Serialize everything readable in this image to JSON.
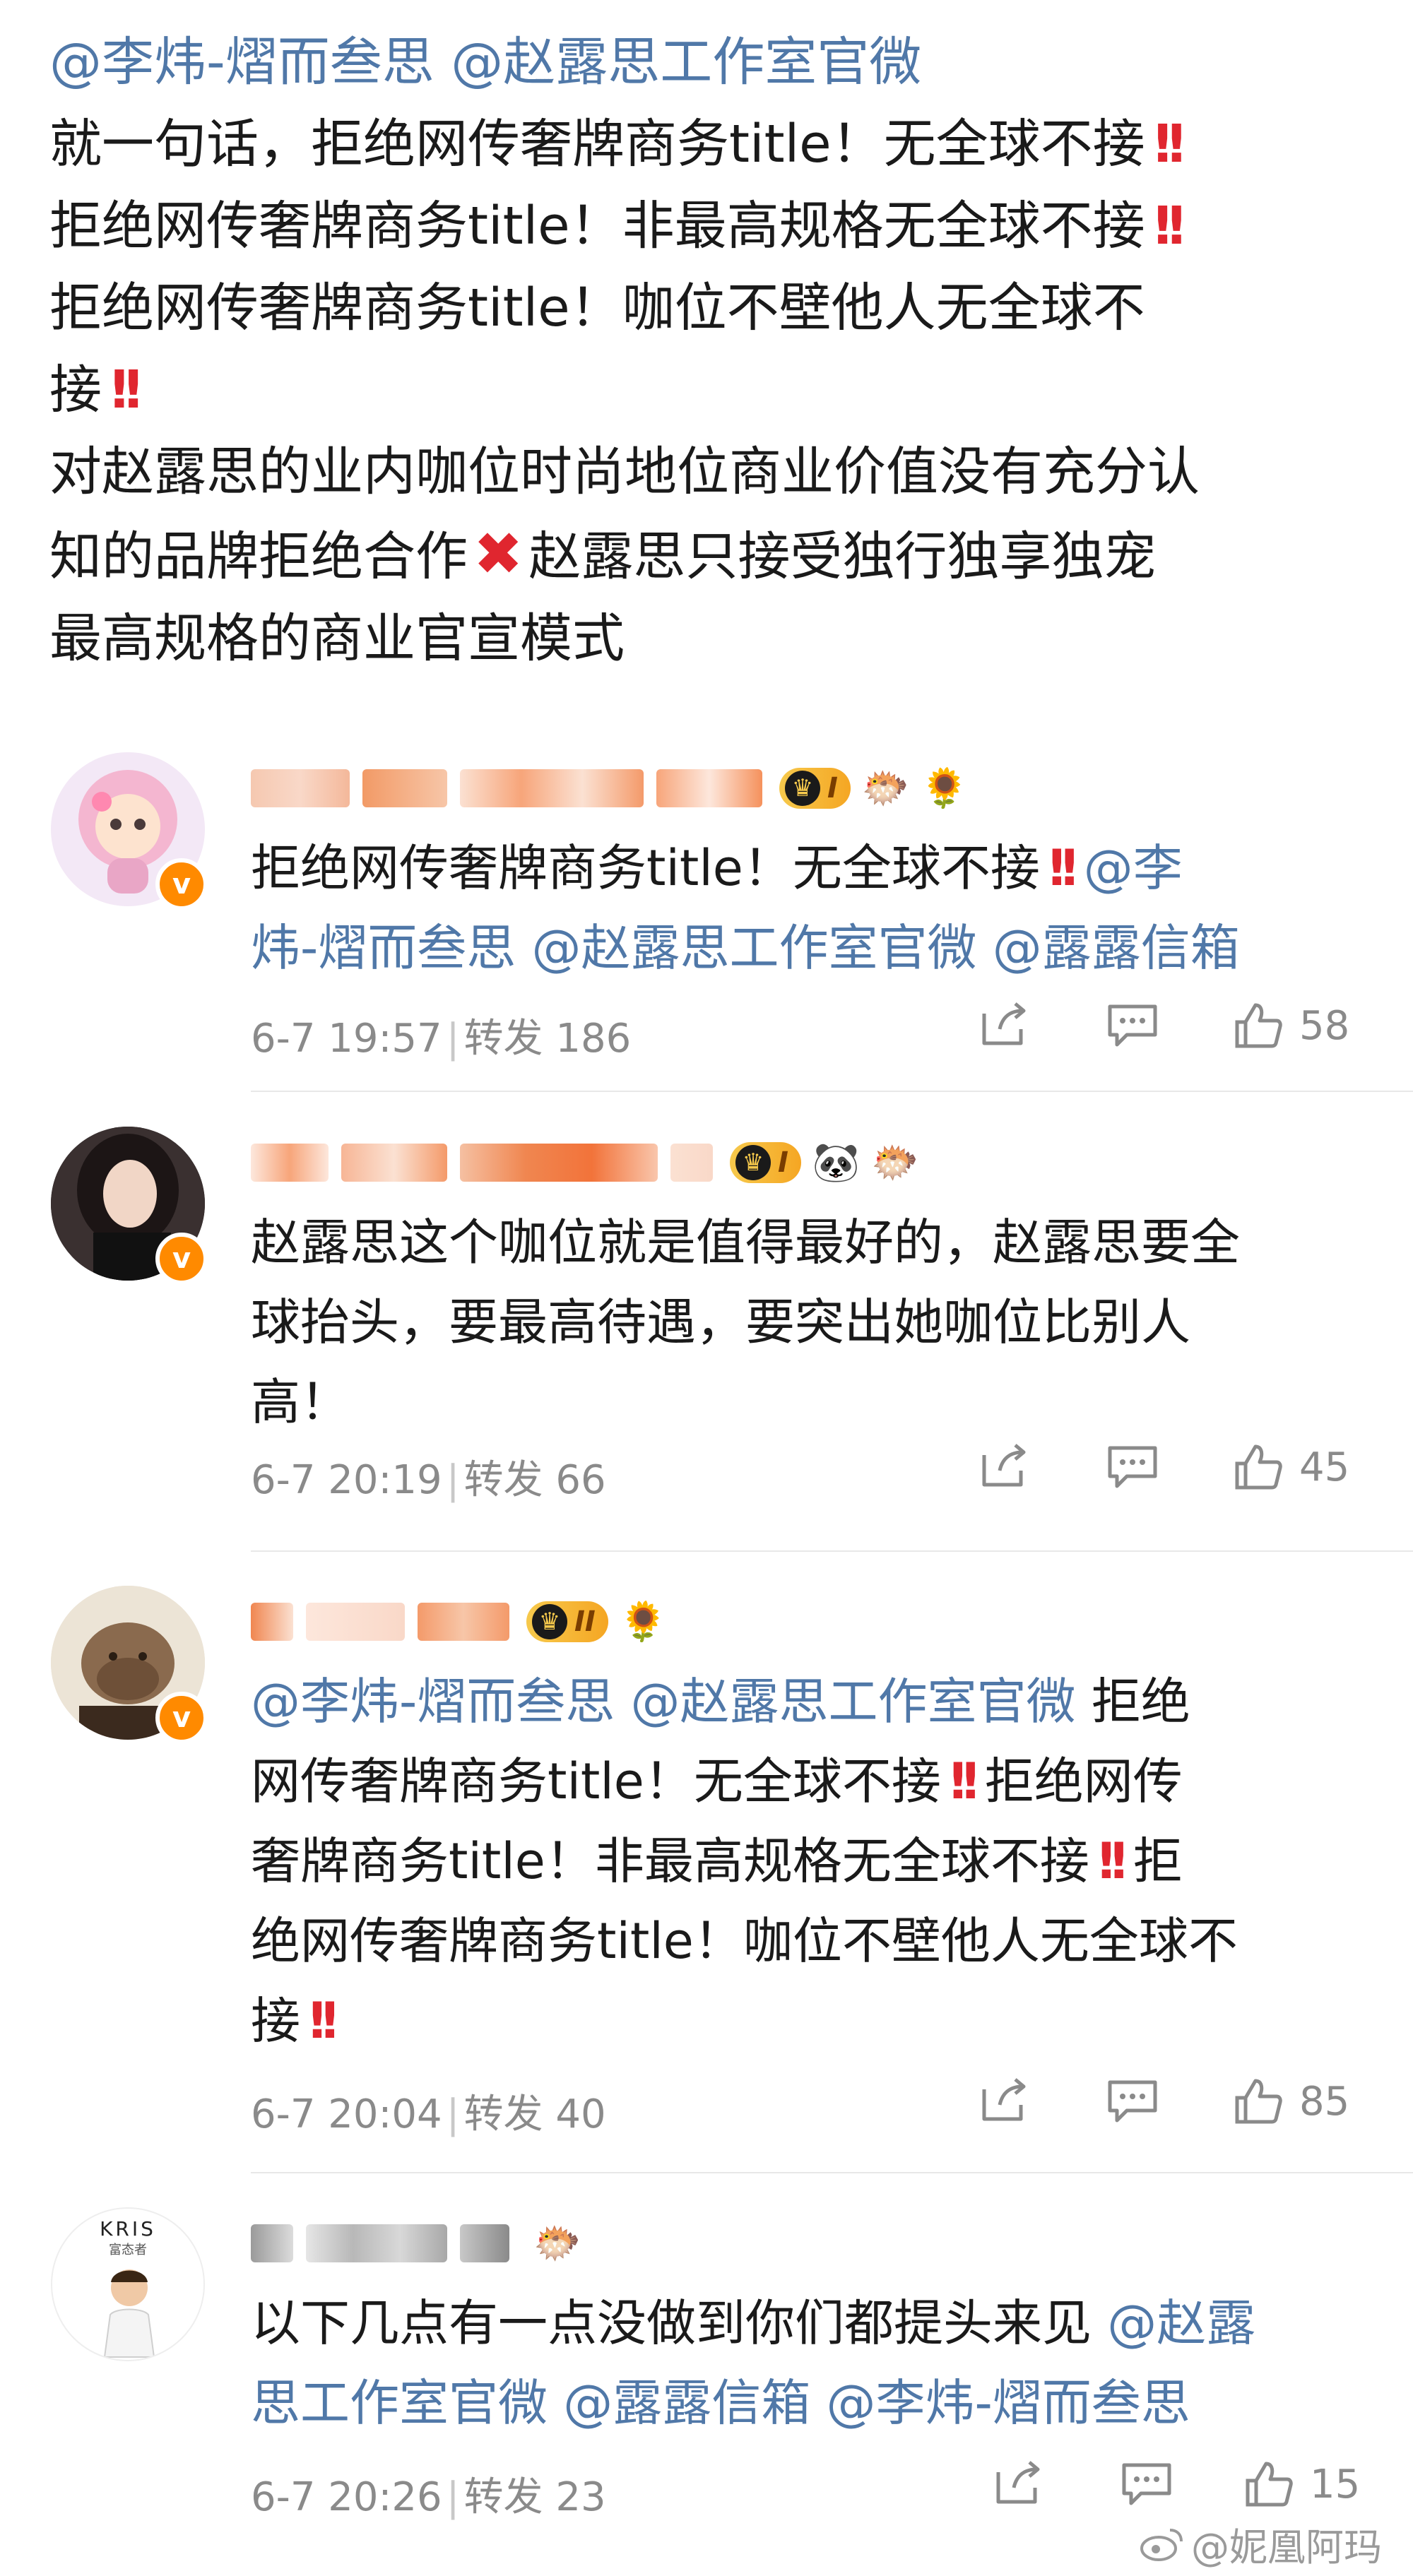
{
  "post": {
    "lines": [
      [
        "@李炜-熠而叁思 @赵露思工作室官微"
      ],
      [
        "就一句话，拒绝网传奢牌商务title！无全球不接"
      ],
      [
        "拒绝网传奢牌商务title！非最高规格无全球不接"
      ],
      [
        "拒绝网传奢牌商务title！咖位不壁他人无全球不"
      ],
      [
        "接"
      ],
      [
        "对赵露思的业内咖位时尚地位商业价值没有充分认"
      ],
      [
        "知的品牌拒绝合作",
        "赵露思只接受独行独享独宠"
      ],
      [
        "最高规格的商业官宣模式"
      ]
    ],
    "bang": "!!",
    "xmark": "✖"
  },
  "comments": [
    {
      "text_lines": [
        {
          "plain": "拒绝网传奢牌商务title！无全球不接",
          "bang": "!!",
          "mention": "@李"
        },
        {
          "mention": "炜-熠而叁思 @赵露思工作室官微 @露露信箱"
        }
      ],
      "date": "6-7 19:57",
      "repost_label": "转发",
      "repost_count": "186",
      "likes": "58",
      "rank": "I",
      "emojis": [
        "fish-emoji",
        "flower-emoji"
      ],
      "verified": "v"
    },
    {
      "text_lines": [
        {
          "plain": "赵露思这个咖位就是值得最好的，赵露思要全"
        },
        {
          "plain": "球抬头，要最高待遇，要突出她咖位比别人"
        },
        {
          "plain": "高！"
        }
      ],
      "date": "6-7 20:19",
      "repost_label": "转发",
      "repost_count": "66",
      "likes": "45",
      "rank": "I",
      "emojis": [
        "panda-emoji",
        "fish-emoji"
      ],
      "verified": "v"
    },
    {
      "text_lines": [
        {
          "mention": "@李炜-熠而叁思 @赵露思工作室官微",
          "plain": " 拒绝"
        },
        {
          "plain": "网传奢牌商务title！无全球不接",
          "bang": "!!",
          "plain2": "拒绝网传"
        },
        {
          "plain": "奢牌商务title！非最高规格无全球不接",
          "bang": "!!",
          "plain2": "拒"
        },
        {
          "plain": "绝网传奢牌商务title！咖位不壁他人无全球不"
        },
        {
          "plain": "接",
          "bang": "!!"
        }
      ],
      "date": "6-7 20:04",
      "repost_label": "转发",
      "repost_count": "40",
      "likes": "85",
      "rank": "II",
      "emojis": [
        "flower-emoji"
      ],
      "verified": "v"
    },
    {
      "text_lines": [
        {
          "plain": "以下几点有一点没做到你们都提头来见 ",
          "mention": "@赵露"
        },
        {
          "mention": "思工作室官微 @露露信箱 @李炜-熠而叁思"
        }
      ],
      "date": "6-7 20:26",
      "repost_label": "转发",
      "repost_count": "23",
      "likes": "15",
      "rank": "",
      "emojis": [
        "fish-emoji"
      ],
      "avatar_caption": "KRIS",
      "avatar_subcaption": "富态者",
      "verified": ""
    }
  ],
  "watermark": "@妮凰阿玛",
  "colors": {
    "mention": "#5078a8",
    "alert": "#e0262f",
    "meta": "#8a8a8a",
    "vip": "#ff8a00"
  }
}
